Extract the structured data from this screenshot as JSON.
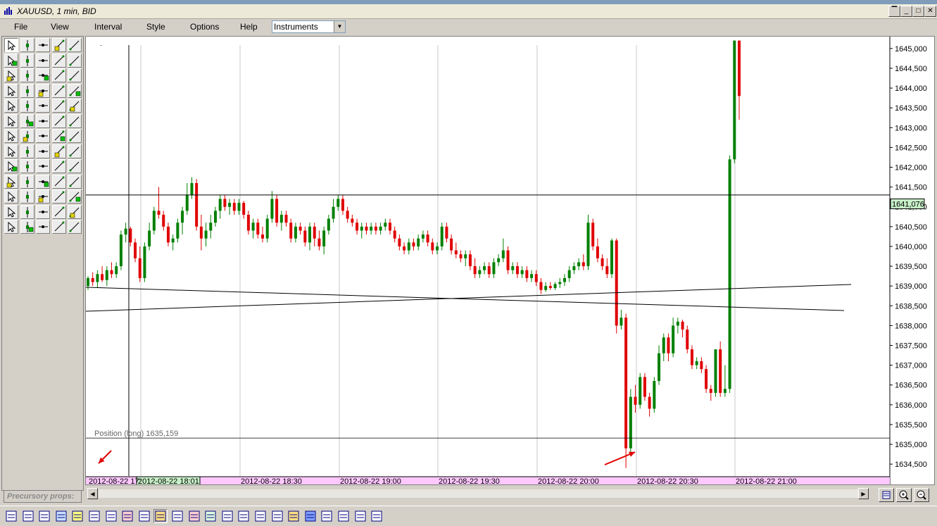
{
  "window": {
    "title": "XAUUSD, 1 min, BID",
    "min_label": "_",
    "max_label": "□",
    "close_label": "✕"
  },
  "menu": {
    "items": [
      "File",
      "View",
      "Interval",
      "Style",
      "Options",
      "Help"
    ],
    "instrument_select": "Instruments"
  },
  "chart_data": {
    "type": "candlestick",
    "ylim": [
      1634.2,
      1645.3
    ],
    "y_ticks": [
      "1645,000",
      "1644,500",
      "1644,000",
      "1643,500",
      "1643,000",
      "1642,500",
      "1642,000",
      "1641,500",
      "1641,000",
      "1640,500",
      "1640,000",
      "1639,500",
      "1639,000",
      "1638,500",
      "1638,000",
      "1637,500",
      "1637,000",
      "1636,500",
      "1636,000",
      "1635,500",
      "1635,000",
      "1634,500"
    ],
    "x_labels": [
      "2012-08-22 17:",
      "2012-08-22 18:01",
      "2012-08-22 18:30",
      "2012-08-22 19:00",
      "2012-08-22 19:30",
      "2012-08-22 20:00",
      "2012-08-22 20:30",
      "2012-08-22 21:00"
    ],
    "current_price": "1641,076",
    "position_label": "Position (long) 1635,159",
    "position_price": 1635.159,
    "horizontal_line_price": 1641.3,
    "colors": {
      "up": "#008000",
      "down": "#e00000",
      "grid": "#c8c8c8",
      "cursor_label_bg": "#c8f0c8",
      "axis_bg": "#ffc8ff"
    },
    "candles": [
      {
        "o": 1639.0,
        "h": 1639.25,
        "l": 1638.9,
        "c": 1639.2
      },
      {
        "o": 1639.2,
        "h": 1639.35,
        "l": 1639.0,
        "c": 1639.1
      },
      {
        "o": 1639.1,
        "h": 1639.4,
        "l": 1638.95,
        "c": 1639.3
      },
      {
        "o": 1639.3,
        "h": 1639.5,
        "l": 1639.1,
        "c": 1639.15
      },
      {
        "o": 1639.15,
        "h": 1639.5,
        "l": 1639.0,
        "c": 1639.4
      },
      {
        "o": 1639.4,
        "h": 1639.6,
        "l": 1639.2,
        "c": 1639.3
      },
      {
        "o": 1639.3,
        "h": 1639.6,
        "l": 1639.2,
        "c": 1639.5
      },
      {
        "o": 1639.5,
        "h": 1640.4,
        "l": 1639.4,
        "c": 1640.3
      },
      {
        "o": 1640.3,
        "h": 1640.6,
        "l": 1640.1,
        "c": 1640.45
      },
      {
        "o": 1640.45,
        "h": 1640.5,
        "l": 1640.0,
        "c": 1640.1
      },
      {
        "o": 1640.1,
        "h": 1640.2,
        "l": 1639.6,
        "c": 1639.7
      },
      {
        "o": 1639.7,
        "h": 1640.0,
        "l": 1639.1,
        "c": 1639.2
      },
      {
        "o": 1639.2,
        "h": 1640.1,
        "l": 1639.1,
        "c": 1640.0
      },
      {
        "o": 1640.0,
        "h": 1640.6,
        "l": 1639.9,
        "c": 1640.4
      },
      {
        "o": 1640.4,
        "h": 1641.0,
        "l": 1640.3,
        "c": 1640.9
      },
      {
        "o": 1640.9,
        "h": 1641.5,
        "l": 1640.7,
        "c": 1640.8
      },
      {
        "o": 1640.8,
        "h": 1640.9,
        "l": 1640.4,
        "c": 1640.5
      },
      {
        "o": 1640.5,
        "h": 1640.6,
        "l": 1640.0,
        "c": 1640.1
      },
      {
        "o": 1640.1,
        "h": 1640.3,
        "l": 1639.9,
        "c": 1640.2
      },
      {
        "o": 1640.2,
        "h": 1640.7,
        "l": 1640.1,
        "c": 1640.6
      },
      {
        "o": 1640.6,
        "h": 1641.0,
        "l": 1640.3,
        "c": 1640.9
      },
      {
        "o": 1640.9,
        "h": 1641.6,
        "l": 1640.8,
        "c": 1641.3
      },
      {
        "o": 1641.3,
        "h": 1641.75,
        "l": 1641.2,
        "c": 1641.6
      },
      {
        "o": 1641.6,
        "h": 1641.7,
        "l": 1640.4,
        "c": 1640.5
      },
      {
        "o": 1640.5,
        "h": 1640.8,
        "l": 1639.9,
        "c": 1640.2
      },
      {
        "o": 1640.2,
        "h": 1640.6,
        "l": 1640.0,
        "c": 1640.4
      },
      {
        "o": 1640.4,
        "h": 1640.8,
        "l": 1640.2,
        "c": 1640.6
      },
      {
        "o": 1640.6,
        "h": 1641.0,
        "l": 1640.5,
        "c": 1640.9
      },
      {
        "o": 1640.9,
        "h": 1641.3,
        "l": 1640.7,
        "c": 1641.2
      },
      {
        "o": 1641.2,
        "h": 1641.3,
        "l": 1640.9,
        "c": 1641.0
      },
      {
        "o": 1641.0,
        "h": 1641.2,
        "l": 1640.8,
        "c": 1641.1
      },
      {
        "o": 1641.1,
        "h": 1641.2,
        "l": 1640.8,
        "c": 1640.9
      },
      {
        "o": 1640.9,
        "h": 1641.2,
        "l": 1640.8,
        "c": 1641.1
      },
      {
        "o": 1641.1,
        "h": 1641.15,
        "l": 1640.7,
        "c": 1640.8
      },
      {
        "o": 1640.8,
        "h": 1640.9,
        "l": 1640.3,
        "c": 1640.4
      },
      {
        "o": 1640.4,
        "h": 1640.7,
        "l": 1640.2,
        "c": 1640.6
      },
      {
        "o": 1640.6,
        "h": 1640.7,
        "l": 1640.2,
        "c": 1640.3
      },
      {
        "o": 1640.3,
        "h": 1640.5,
        "l": 1640.1,
        "c": 1640.2
      },
      {
        "o": 1640.2,
        "h": 1640.8,
        "l": 1640.1,
        "c": 1640.7
      },
      {
        "o": 1640.7,
        "h": 1641.4,
        "l": 1640.6,
        "c": 1641.2
      },
      {
        "o": 1641.2,
        "h": 1641.3,
        "l": 1640.5,
        "c": 1640.6
      },
      {
        "o": 1640.6,
        "h": 1640.9,
        "l": 1640.4,
        "c": 1640.8
      },
      {
        "o": 1640.8,
        "h": 1640.9,
        "l": 1640.5,
        "c": 1640.6
      },
      {
        "o": 1640.6,
        "h": 1640.7,
        "l": 1640.1,
        "c": 1640.2
      },
      {
        "o": 1640.2,
        "h": 1640.6,
        "l": 1640.1,
        "c": 1640.5
      },
      {
        "o": 1640.5,
        "h": 1640.6,
        "l": 1640.3,
        "c": 1640.4
      },
      {
        "o": 1640.4,
        "h": 1640.5,
        "l": 1640.0,
        "c": 1640.1
      },
      {
        "o": 1640.1,
        "h": 1640.6,
        "l": 1639.9,
        "c": 1640.5
      },
      {
        "o": 1640.5,
        "h": 1640.6,
        "l": 1640.0,
        "c": 1640.2
      },
      {
        "o": 1640.2,
        "h": 1640.4,
        "l": 1639.9,
        "c": 1640.0
      },
      {
        "o": 1640.0,
        "h": 1640.5,
        "l": 1639.8,
        "c": 1640.4
      },
      {
        "o": 1640.4,
        "h": 1640.8,
        "l": 1640.3,
        "c": 1640.7
      },
      {
        "o": 1640.7,
        "h": 1641.2,
        "l": 1640.6,
        "c": 1641.0
      },
      {
        "o": 1641.0,
        "h": 1641.3,
        "l": 1640.9,
        "c": 1641.2
      },
      {
        "o": 1641.2,
        "h": 1641.3,
        "l": 1640.8,
        "c": 1640.9
      },
      {
        "o": 1640.9,
        "h": 1641.0,
        "l": 1640.6,
        "c": 1640.7
      },
      {
        "o": 1640.7,
        "h": 1640.8,
        "l": 1640.5,
        "c": 1640.6
      },
      {
        "o": 1640.6,
        "h": 1640.7,
        "l": 1640.3,
        "c": 1640.4
      },
      {
        "o": 1640.4,
        "h": 1640.6,
        "l": 1640.2,
        "c": 1640.5
      },
      {
        "o": 1640.5,
        "h": 1640.6,
        "l": 1640.3,
        "c": 1640.4
      },
      {
        "o": 1640.4,
        "h": 1640.6,
        "l": 1640.3,
        "c": 1640.5
      },
      {
        "o": 1640.5,
        "h": 1640.6,
        "l": 1640.3,
        "c": 1640.4
      },
      {
        "o": 1640.4,
        "h": 1640.6,
        "l": 1640.3,
        "c": 1640.5
      },
      {
        "o": 1640.5,
        "h": 1640.7,
        "l": 1640.4,
        "c": 1640.6
      },
      {
        "o": 1640.6,
        "h": 1640.7,
        "l": 1640.3,
        "c": 1640.4
      },
      {
        "o": 1640.4,
        "h": 1640.5,
        "l": 1640.1,
        "c": 1640.2
      },
      {
        "o": 1640.2,
        "h": 1640.3,
        "l": 1639.9,
        "c": 1640.0
      },
      {
        "o": 1640.0,
        "h": 1640.1,
        "l": 1639.8,
        "c": 1639.9
      },
      {
        "o": 1639.9,
        "h": 1640.2,
        "l": 1639.8,
        "c": 1640.1
      },
      {
        "o": 1640.1,
        "h": 1640.2,
        "l": 1639.9,
        "c": 1640.0
      },
      {
        "o": 1640.0,
        "h": 1640.3,
        "l": 1639.9,
        "c": 1640.2
      },
      {
        "o": 1640.2,
        "h": 1640.4,
        "l": 1640.1,
        "c": 1640.3
      },
      {
        "o": 1640.3,
        "h": 1640.4,
        "l": 1640.0,
        "c": 1640.1
      },
      {
        "o": 1640.1,
        "h": 1640.2,
        "l": 1639.8,
        "c": 1639.9
      },
      {
        "o": 1639.9,
        "h": 1640.1,
        "l": 1639.8,
        "c": 1640.0
      },
      {
        "o": 1640.0,
        "h": 1640.6,
        "l": 1639.9,
        "c": 1640.5
      },
      {
        "o": 1640.5,
        "h": 1640.6,
        "l": 1640.1,
        "c": 1640.2
      },
      {
        "o": 1640.2,
        "h": 1640.3,
        "l": 1639.8,
        "c": 1639.9
      },
      {
        "o": 1639.9,
        "h": 1640.1,
        "l": 1639.7,
        "c": 1639.8
      },
      {
        "o": 1639.8,
        "h": 1639.9,
        "l": 1639.6,
        "c": 1639.7
      },
      {
        "o": 1639.7,
        "h": 1639.9,
        "l": 1639.5,
        "c": 1639.8
      },
      {
        "o": 1639.8,
        "h": 1639.9,
        "l": 1639.4,
        "c": 1639.5
      },
      {
        "o": 1639.5,
        "h": 1639.7,
        "l": 1639.2,
        "c": 1639.3
      },
      {
        "o": 1639.3,
        "h": 1639.5,
        "l": 1639.2,
        "c": 1639.4
      },
      {
        "o": 1639.4,
        "h": 1639.6,
        "l": 1639.3,
        "c": 1639.5
      },
      {
        "o": 1639.5,
        "h": 1639.6,
        "l": 1639.2,
        "c": 1639.3
      },
      {
        "o": 1639.3,
        "h": 1639.7,
        "l": 1639.2,
        "c": 1639.6
      },
      {
        "o": 1639.6,
        "h": 1639.8,
        "l": 1639.5,
        "c": 1639.7
      },
      {
        "o": 1639.7,
        "h": 1640.2,
        "l": 1639.6,
        "c": 1639.9
      },
      {
        "o": 1639.9,
        "h": 1640.0,
        "l": 1639.3,
        "c": 1639.4
      },
      {
        "o": 1639.4,
        "h": 1639.6,
        "l": 1639.3,
        "c": 1639.5
      },
      {
        "o": 1639.5,
        "h": 1639.6,
        "l": 1639.2,
        "c": 1639.3
      },
      {
        "o": 1639.3,
        "h": 1639.5,
        "l": 1639.2,
        "c": 1639.4
      },
      {
        "o": 1639.4,
        "h": 1639.5,
        "l": 1639.1,
        "c": 1639.2
      },
      {
        "o": 1639.2,
        "h": 1639.4,
        "l": 1639.1,
        "c": 1639.3
      },
      {
        "o": 1639.3,
        "h": 1639.4,
        "l": 1639.0,
        "c": 1639.1
      },
      {
        "o": 1639.1,
        "h": 1639.2,
        "l": 1638.8,
        "c": 1638.9
      },
      {
        "o": 1638.9,
        "h": 1639.1,
        "l": 1638.85,
        "c": 1639.0
      },
      {
        "o": 1639.0,
        "h": 1639.1,
        "l": 1638.9,
        "c": 1638.95
      },
      {
        "o": 1638.95,
        "h": 1639.1,
        "l": 1638.9,
        "c": 1639.05
      },
      {
        "o": 1639.05,
        "h": 1639.2,
        "l": 1638.95,
        "c": 1639.1
      },
      {
        "o": 1639.1,
        "h": 1639.3,
        "l": 1639.0,
        "c": 1639.2
      },
      {
        "o": 1639.2,
        "h": 1639.5,
        "l": 1639.1,
        "c": 1639.4
      },
      {
        "o": 1639.4,
        "h": 1639.6,
        "l": 1639.3,
        "c": 1639.5
      },
      {
        "o": 1639.5,
        "h": 1639.7,
        "l": 1639.4,
        "c": 1639.6
      },
      {
        "o": 1639.6,
        "h": 1639.8,
        "l": 1639.4,
        "c": 1639.5
      },
      {
        "o": 1639.5,
        "h": 1640.8,
        "l": 1639.4,
        "c": 1640.6
      },
      {
        "o": 1640.6,
        "h": 1640.7,
        "l": 1639.9,
        "c": 1640.0
      },
      {
        "o": 1640.0,
        "h": 1640.2,
        "l": 1639.6,
        "c": 1639.7
      },
      {
        "o": 1639.7,
        "h": 1639.8,
        "l": 1639.4,
        "c": 1639.5
      },
      {
        "o": 1639.5,
        "h": 1639.7,
        "l": 1639.2,
        "c": 1639.3
      },
      {
        "o": 1639.3,
        "h": 1640.2,
        "l": 1639.2,
        "c": 1640.15
      },
      {
        "o": 1640.15,
        "h": 1640.2,
        "l": 1637.8,
        "c": 1638.0
      },
      {
        "o": 1638.0,
        "h": 1638.4,
        "l": 1637.9,
        "c": 1638.2
      },
      {
        "o": 1638.2,
        "h": 1638.3,
        "l": 1634.4,
        "c": 1634.9
      },
      {
        "o": 1634.9,
        "h": 1636.4,
        "l": 1634.7,
        "c": 1636.2
      },
      {
        "o": 1636.2,
        "h": 1636.5,
        "l": 1635.8,
        "c": 1636.0
      },
      {
        "o": 1636.0,
        "h": 1636.8,
        "l": 1635.9,
        "c": 1636.7
      },
      {
        "o": 1636.7,
        "h": 1636.8,
        "l": 1636.1,
        "c": 1636.2
      },
      {
        "o": 1636.2,
        "h": 1636.3,
        "l": 1635.7,
        "c": 1635.9
      },
      {
        "o": 1635.9,
        "h": 1636.7,
        "l": 1635.8,
        "c": 1636.6
      },
      {
        "o": 1636.6,
        "h": 1637.5,
        "l": 1636.5,
        "c": 1637.3
      },
      {
        "o": 1637.3,
        "h": 1637.8,
        "l": 1637.1,
        "c": 1637.7
      },
      {
        "o": 1637.7,
        "h": 1637.8,
        "l": 1637.1,
        "c": 1637.3
      },
      {
        "o": 1637.3,
        "h": 1638.2,
        "l": 1637.2,
        "c": 1638.0
      },
      {
        "o": 1638.0,
        "h": 1638.2,
        "l": 1637.8,
        "c": 1638.1
      },
      {
        "o": 1638.1,
        "h": 1638.15,
        "l": 1637.7,
        "c": 1637.9
      },
      {
        "o": 1637.9,
        "h": 1638.0,
        "l": 1637.3,
        "c": 1637.4
      },
      {
        "o": 1637.4,
        "h": 1637.5,
        "l": 1636.9,
        "c": 1637.0
      },
      {
        "o": 1637.0,
        "h": 1637.2,
        "l": 1636.9,
        "c": 1637.1
      },
      {
        "o": 1637.1,
        "h": 1637.2,
        "l": 1636.8,
        "c": 1636.9
      },
      {
        "o": 1636.9,
        "h": 1637.0,
        "l": 1636.3,
        "c": 1636.4
      },
      {
        "o": 1636.4,
        "h": 1636.5,
        "l": 1636.1,
        "c": 1636.3
      },
      {
        "o": 1636.3,
        "h": 1637.4,
        "l": 1636.2,
        "c": 1637.4
      },
      {
        "o": 1637.4,
        "h": 1637.6,
        "l": 1636.2,
        "c": 1636.3
      },
      {
        "o": 1636.3,
        "h": 1637.0,
        "l": 1636.2,
        "c": 1636.4
      },
      {
        "o": 1636.4,
        "h": 1642.3,
        "l": 1636.3,
        "c": 1642.2
      },
      {
        "o": 1642.2,
        "h": 1645.2,
        "l": 1642.1,
        "c": 1645.2
      },
      {
        "o": 1645.2,
        "h": 1645.2,
        "l": 1643.2,
        "c": 1643.8
      }
    ]
  },
  "side_panel": {
    "precursory_label": "Precursory props:"
  },
  "tools": {
    "left_count": 65,
    "bottom": [
      "pencil-icon",
      "list-icon",
      "panel-icon",
      "zoom-icon",
      "columns-icon",
      "text-cursor-icon",
      "crosshair-icon",
      "grid-icon",
      "period-icon",
      "palette-icon",
      "table-icon",
      "bars-icon",
      "chart-icon",
      "network-icon",
      "candles-icon",
      "bars2-icon",
      "bars3-icon",
      "folder-icon",
      "save-icon",
      "chart2-icon",
      "people-icon",
      "grid2-icon",
      "calculator-icon"
    ]
  }
}
